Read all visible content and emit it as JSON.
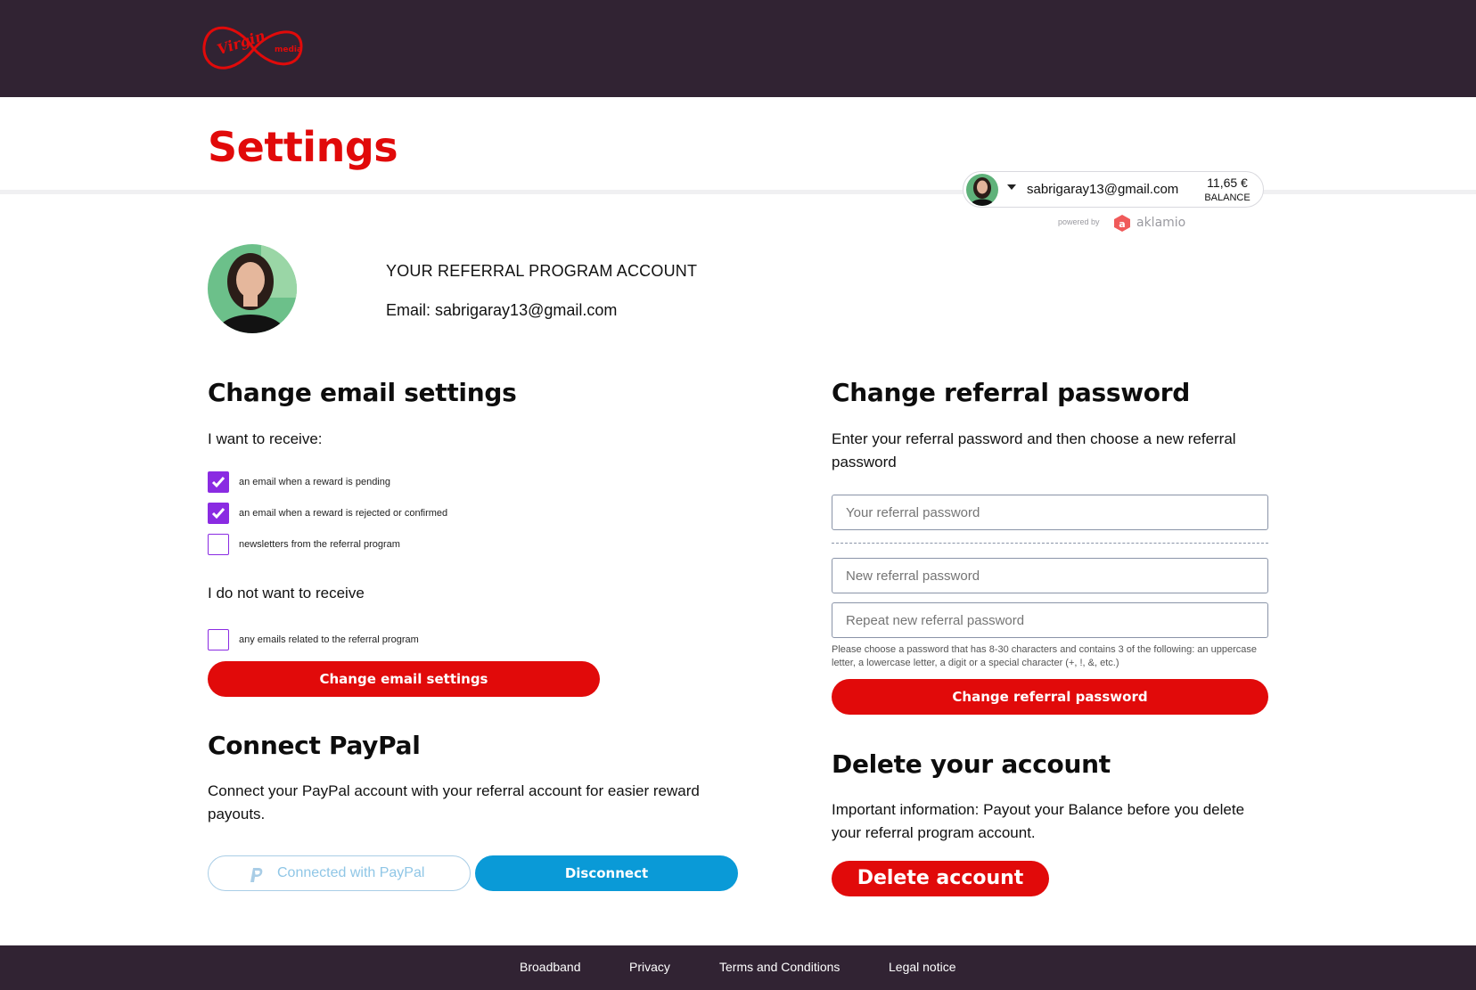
{
  "header": {
    "logo_text": "Virgin media"
  },
  "page": {
    "title": "Settings"
  },
  "account_pill": {
    "email": "sabrigaray13@gmail.com",
    "balance": "11,65 €",
    "balance_label": "BALANCE"
  },
  "powered_by": {
    "label": "powered by",
    "brand": "aklamio"
  },
  "profile": {
    "heading": "YOUR REFERRAL PROGRAM ACCOUNT",
    "email_line": "Email: sabrigaray13@gmail.com"
  },
  "email_settings": {
    "title": "Change email settings",
    "receive_label": "I want to receive:",
    "options": [
      {
        "label": "an email when a reward is pending",
        "checked": true
      },
      {
        "label": "an email when a reward is rejected or confirmed",
        "checked": true
      },
      {
        "label": "newsletters from the referral program",
        "checked": false
      }
    ],
    "not_receive_label": "I do not want to receive",
    "opt_out": {
      "label": "any emails related to the referral program",
      "checked": false
    },
    "button": "Change email settings"
  },
  "password": {
    "title": "Change referral password",
    "description": "Enter your referral password and then choose a new referral password",
    "current_placeholder": "Your referral password",
    "new_placeholder": "New referral password",
    "repeat_placeholder": "Repeat new referral password",
    "hint": "Please choose a password that has 8-30 characters and contains 3 of the following: an uppercase letter, a lowercase letter, a digit or a special character (+, !, &, etc.)",
    "button": "Change referral password"
  },
  "paypal": {
    "title": "Connect PayPal",
    "description": "Connect your PayPal account with your referral account for easier reward payouts.",
    "connected_label": "Connected with PayPal",
    "disconnect_label": "Disconnect"
  },
  "delete": {
    "title": "Delete your account",
    "description": "Important information: Payout your Balance before you delete your referral program account.",
    "button": "Delete account"
  },
  "footer": {
    "links": [
      "Broadband",
      "Privacy",
      "Terms and Conditions",
      "Legal notice"
    ]
  },
  "colors": {
    "brand_red": "#e10a0a",
    "header_bg": "#312333",
    "checkbox_purple": "#8a2be2",
    "paypal_blue": "#0a9ad7"
  },
  "icons": {
    "logo": "virgin-media-logo",
    "checkbox": "checkmark-icon",
    "paypal": "paypal-icon",
    "caret": "caret-down-icon",
    "aklamio": "aklamio-logo-icon"
  }
}
